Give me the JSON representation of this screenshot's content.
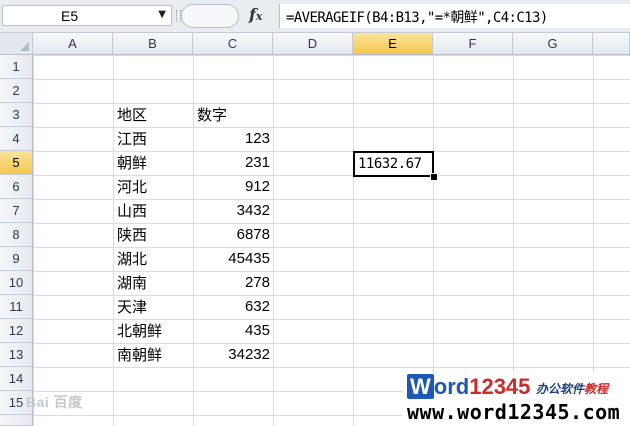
{
  "name_box": {
    "value": "E5"
  },
  "formula_bar": {
    "formula": "=AVERAGEIF(B4:B13,\"=*朝鲜\",C4:C13)",
    "fx_label": "fx"
  },
  "columns": [
    "A",
    "B",
    "C",
    "D",
    "E",
    "F",
    "G"
  ],
  "rows": [
    "1",
    "2",
    "3",
    "4",
    "5",
    "6",
    "7",
    "8",
    "9",
    "10",
    "11",
    "12",
    "13",
    "14",
    "15"
  ],
  "selected_column": "E",
  "selected_row": "5",
  "cells": {
    "B3": "地区",
    "C3": "数字",
    "B4": "江西",
    "C4": "123",
    "B5": "朝鲜",
    "C5": "231",
    "B6": "河北",
    "C6": "912",
    "B7": "山西",
    "C7": "3432",
    "B8": "陕西",
    "C8": "6878",
    "B9": "湖北",
    "C9": "45435",
    "B10": "湖南",
    "C10": "278",
    "B11": "天津",
    "C11": "632",
    "B12": "北朝鲜",
    "C12": "435",
    "B13": "南朝鲜",
    "C13": "34232",
    "E5": "11632.67"
  },
  "watermarks": {
    "baidu": "Bai 百度",
    "brand_w": "W",
    "brand_ord": "ord",
    "brand_num": "12345",
    "brand_tag_a": "办公软件",
    "brand_tag_b": "教程",
    "brand_url": "www.word12345.com"
  }
}
